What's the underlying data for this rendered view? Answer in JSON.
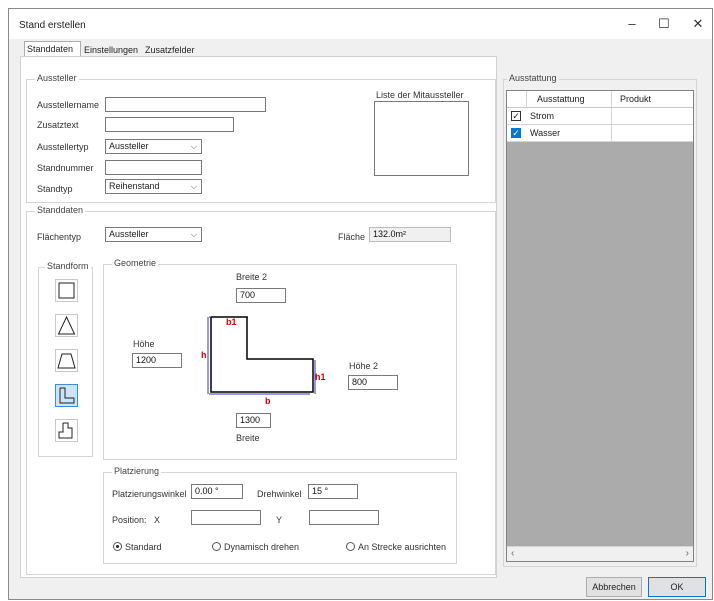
{
  "window": {
    "title": "Stand erstellen",
    "minimize": "–",
    "maximize": "☐",
    "close": "✕"
  },
  "tabs": [
    "Standdaten",
    "Einstellungen",
    "Zusatzfelder"
  ],
  "aussteller": {
    "group_title": "Aussteller",
    "name_label": "Ausstellername",
    "name_value": "",
    "zusatz_label": "Zusatztext",
    "zusatz_value": "",
    "typ_label": "Ausstellertyp",
    "typ_value": "Aussteller",
    "standnummer_label": "Standnummer",
    "standnummer_value": "",
    "standtyp_label": "Standtyp",
    "standtyp_value": "Reihenstand",
    "mitaussteller_label": "Liste der Mitaussteller"
  },
  "standdaten": {
    "group_title": "Standdaten",
    "flaechentyp_label": "Flächentyp",
    "flaechentyp_value": "Aussteller",
    "flaeche_label": "Fläche",
    "flaeche_value": "132.0m²",
    "standform_title": "Standform",
    "geometrie_title": "Geometrie",
    "breite2_label": "Breite 2",
    "breite2_value": "700",
    "hoehe_label": "Höhe",
    "hoehe_value": "1200",
    "hoehe2_label": "Höhe 2",
    "hoehe2_value": "800",
    "breite_label": "Breite",
    "breite_value": "1300",
    "dim_b1_top": "b1",
    "dim_h": "h",
    "dim_h1": "h1",
    "dim_b": "b"
  },
  "platzierung": {
    "group_title": "Platzierung",
    "winkel_label": "Platzierungswinkel",
    "winkel_value": "0.00 °",
    "dreh_label": "Drehwinkel",
    "dreh_value": "15 °",
    "position_label": "Position:",
    "x_label": "X",
    "x_value": "",
    "y_label": "Y",
    "y_value": "",
    "radio_standard": "Standard",
    "radio_dynamisch": "Dynamisch drehen",
    "radio_strecke": "An Strecke ausrichten"
  },
  "ausstattung": {
    "group_title": "Ausstattung",
    "col1": "Ausstattung",
    "col2": "Produkt",
    "rows": [
      {
        "name": "Strom",
        "produkt": "",
        "checked": true,
        "selected": false
      },
      {
        "name": "Wasser",
        "produkt": "",
        "checked": true,
        "selected": true
      }
    ],
    "scroll_left": "‹",
    "scroll_right": "›"
  },
  "buttons": {
    "cancel": "Abbrechen",
    "ok": "OK"
  },
  "colors": {
    "accent": "#0078d7",
    "dim_red": "#d40000",
    "dim_blue": "#3333cc"
  }
}
